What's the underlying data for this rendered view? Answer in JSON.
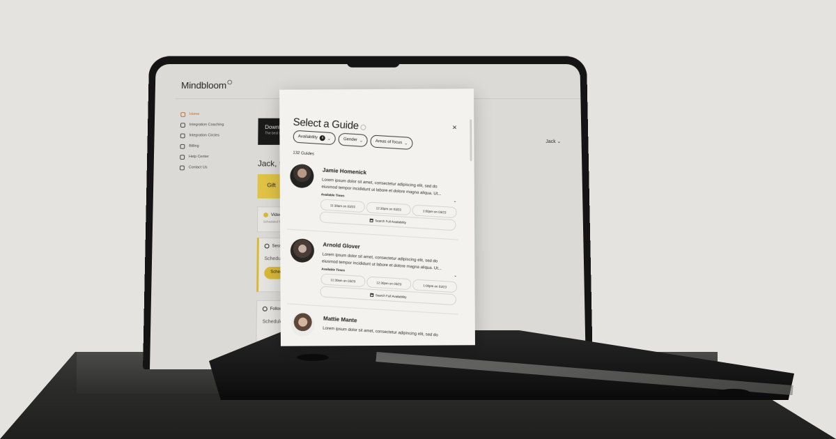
{
  "app": {
    "brand": "Mindbloom",
    "user_menu": "Jack ⌄"
  },
  "sidebar": {
    "items": [
      {
        "label": "Home",
        "icon": "home-icon",
        "active": true
      },
      {
        "label": "Integration Coaching",
        "icon": "person-icon"
      },
      {
        "label": "Integration Circles",
        "icon": "group-icon"
      },
      {
        "label": "Billing",
        "icon": "card-icon"
      },
      {
        "label": "Help Center",
        "icon": "help-icon"
      },
      {
        "label": "Contact Us",
        "icon": "mail-icon"
      }
    ]
  },
  "dashboard": {
    "banner_title": "Download",
    "banner_sub": "The best way",
    "greeting": "Jack, take",
    "gift_label": "Gift",
    "task1_title": "Video C",
    "task1_sub": "Scheduled for",
    "task2_title": "Session",
    "task2_sub": "Schedule w",
    "task2_button": "Schedu",
    "task3_title": "Follow-",
    "task3_sub": "Schedule w"
  },
  "modal": {
    "title": "Select a Guide",
    "close": "×",
    "filters": [
      {
        "label": "Availability",
        "badge": "4"
      },
      {
        "label": "Gender"
      },
      {
        "label": "Areas of focus"
      }
    ],
    "count": "132 Guides",
    "available_label": "Available Times",
    "full_availability": "Search Full Availability",
    "guides": [
      {
        "name": "Jamie Homenick",
        "bio": "Lorem ipsum dolor sit amet, consectetur adipiscing elit, sed do eiusmod tempor incididunt ut labore et dolore magna aliqua. Ut...",
        "slots": [
          "11:30am on 03/23",
          "12:30pm on 03/23",
          "1:00pm on 03/23"
        ]
      },
      {
        "name": "Arnold Glover",
        "bio": "Lorem ipsum dolor sit amet, consectetur adipiscing elit, sed do eiusmod tempor incididunt ut labore et dolore magna aliqua. Ut...",
        "slots": [
          "11:30am on 03/23",
          "12:30pm on 03/23",
          "1:00pm on 03/23"
        ]
      },
      {
        "name": "Mattie Mante",
        "bio": "Lorem ipsum dolor sit amet, consectetur adipiscing elit, sed do"
      }
    ]
  }
}
